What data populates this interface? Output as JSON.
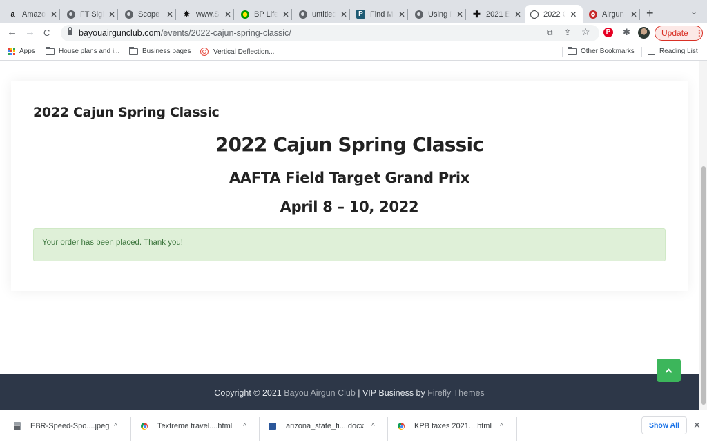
{
  "browser": {
    "tabs": [
      {
        "title": "Amazon",
        "icon": "amazon-icon"
      },
      {
        "title": "FT Sight",
        "icon": "globe-icon"
      },
      {
        "title": "Scope",
        "icon": "globe-icon"
      },
      {
        "title": "www.Sl",
        "icon": "bullet-hole-icon"
      },
      {
        "title": "BP Life",
        "icon": "bp-icon"
      },
      {
        "title": "untitled",
        "icon": "globe-icon"
      },
      {
        "title": "Find M",
        "icon": "p-icon"
      },
      {
        "title": "Using F",
        "icon": "globe-icon"
      },
      {
        "title": "2021 E",
        "icon": "cross-icon"
      },
      {
        "title": "2022 C",
        "icon": "clock-icon",
        "active": true
      },
      {
        "title": "Airgun",
        "icon": "airgun-icon"
      }
    ],
    "new_tab_glyph": "+",
    "tab_menu_glyph": "⌄",
    "close_glyph": "✕",
    "url_domain": "bayouairgunclub.com",
    "url_path": "/events/2022-cajun-spring-classic/",
    "update_label": "Update",
    "update_menu_glyph": "⋮",
    "pinterest_glyph": "P",
    "puzzle_glyph": "✱",
    "back_glyph": "←",
    "forward_glyph": "→",
    "reload_glyph": "C",
    "translate_glyph": "⧉",
    "share_glyph": "⇪",
    "star_glyph": "☆",
    "apps_colors": [
      "#ea4335",
      "#fbbc04",
      "#34a853",
      "#4285f4",
      "#ea4335",
      "#fbbc04",
      "#34a853",
      "#4285f4",
      "#ea4335"
    ]
  },
  "bookmarks": {
    "items": [
      {
        "label": "Apps",
        "icon": "apps-icon"
      },
      {
        "label": "House plans and i...",
        "icon": "folder-icon"
      },
      {
        "label": "Business pages",
        "icon": "folder-icon"
      },
      {
        "label": "Vertical Deflection...",
        "icon": "target-icon"
      }
    ],
    "other": "Other Bookmarks",
    "reading_list": "Reading List"
  },
  "page": {
    "card_title": "2022 Cajun Spring Classic",
    "hero_title": "2022 Cajun Spring Classic",
    "hero_subtitle": "AAFTA Field Target Grand Prix",
    "hero_date": "April 8 – 10, 2022",
    "alert_message": "Your order has been placed. Thank you!",
    "footer": {
      "prefix": "Copyright © 2021 ",
      "site_link": "Bayou Airgun Club",
      "middle": " | VIP Business by ",
      "theme_link": "Firefly Themes"
    },
    "colors": {
      "alert_bg": "#dff0d8",
      "alert_text": "#3c763d",
      "footer_bg": "#2d3748",
      "scroll_top_bg": "#3cb65b"
    }
  },
  "downloads": {
    "items": [
      {
        "name": "EBR-Speed-Spo....jpeg",
        "icon": "image-file-icon"
      },
      {
        "name": "Textreme travel....html",
        "icon": "chrome-file-icon"
      },
      {
        "name": "arizona_state_fi....docx",
        "icon": "word-file-icon"
      },
      {
        "name": "KPB taxes 2021....html",
        "icon": "chrome-file-icon"
      }
    ],
    "caret_glyph": "^",
    "show_all_label": "Show All",
    "close_glyph": "✕"
  }
}
